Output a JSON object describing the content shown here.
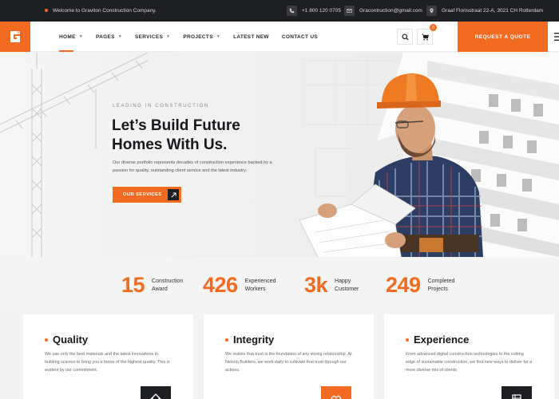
{
  "topbar": {
    "welcome": "Welcome to Graviton Construction Company.",
    "phone": "+1 800 120 0705",
    "email": "Gracontruction@gmail.com",
    "address": "Graaf Florisstraat 22-A, 3021 CH Rotterdam"
  },
  "header": {
    "nav": [
      {
        "label": "HOME",
        "active": true,
        "dropdown": true
      },
      {
        "label": "PAGES",
        "dropdown": true
      },
      {
        "label": "SERVICES",
        "dropdown": true
      },
      {
        "label": "PROJECTS",
        "dropdown": true
      },
      {
        "label": "LATEST NEW"
      },
      {
        "label": "CONTACT US"
      }
    ],
    "cart_count": "0",
    "quote_label": "REQUEST A QUOTE"
  },
  "hero": {
    "eyebrow": "LEADING IN CONSTRUCTION",
    "title_line1": "Let’s Build Future",
    "title_line2": "Homes With Us.",
    "description": "Our diverse portfolio represents decades of construction experience backed by a passion for quality, outstanding client service and the latest industry.",
    "cta_label": "OUR SERVICES"
  },
  "stats": [
    {
      "value": "15",
      "label_line1": "Construction",
      "label_line2": "Award"
    },
    {
      "value": "426",
      "label_line1": "Experienced",
      "label_line2": "Workers"
    },
    {
      "value": "3k",
      "label_line1": "Happy",
      "label_line2": "Customer"
    },
    {
      "value": "249",
      "label_line1": "Completed",
      "label_line2": "Projects"
    }
  ],
  "cards": [
    {
      "title": "Quality",
      "text": "We use only the best materials and the latest innovations in building science to bring you a home of the highest quality. This is evident by our commitment."
    },
    {
      "title": "Integrity",
      "text": "We realize that trust is the foundation of any strong relationship. At Nelson Builders, we work daily to cultivate that trust through our actions."
    },
    {
      "title": "Experience",
      "text": "From advanced digital construction technologies to the cutting edge of sustainable construction, we find new ways to deliver for a more diverse mix of clients."
    }
  ],
  "colors": {
    "accent": "#f26b21",
    "dark": "#1e1f23"
  },
  "icons": [
    "phone-icon",
    "email-icon",
    "location-icon",
    "search-icon",
    "cart-icon",
    "arrow-right-icon",
    "menu-icon"
  ]
}
